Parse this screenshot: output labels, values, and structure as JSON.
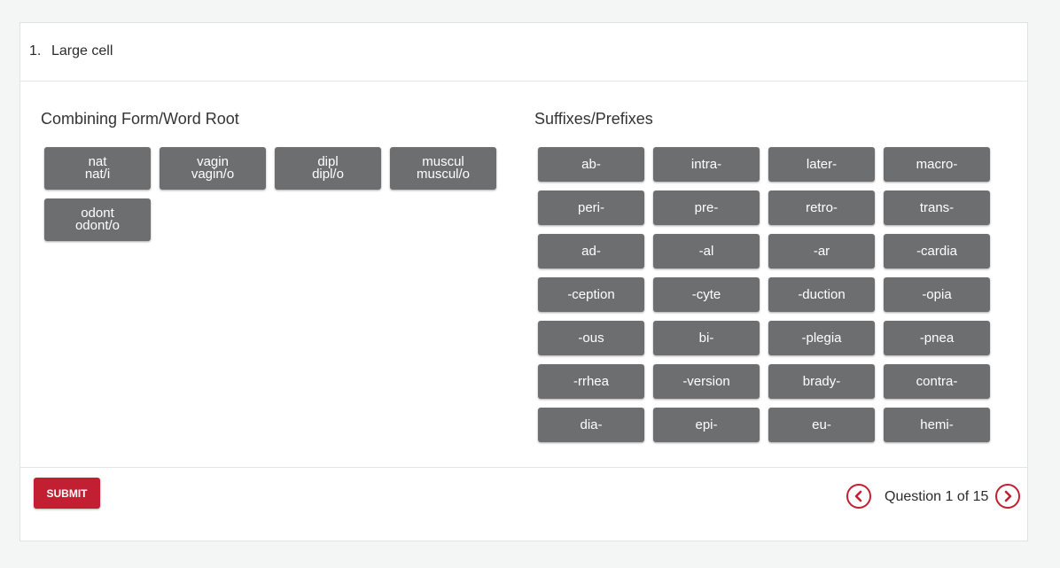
{
  "question": {
    "number": "1.",
    "text": "Large cell"
  },
  "left_section": {
    "title": "Combining Form/Word Root",
    "items": [
      {
        "line1": "nat",
        "line2": "nat/i"
      },
      {
        "line1": "vagin",
        "line2": "vagin/o"
      },
      {
        "line1": "dipl",
        "line2": "dipl/o"
      },
      {
        "line1": "muscul",
        "line2": "muscul/o"
      },
      {
        "line1": "odont",
        "line2": "odont/o"
      }
    ]
  },
  "right_section": {
    "title": "Suffixes/Prefixes",
    "items": [
      "ab-",
      "intra-",
      "later-",
      "macro-",
      "peri-",
      "pre-",
      "retro-",
      "trans-",
      "ad-",
      "-al",
      "-ar",
      "-cardia",
      "-ception",
      "-cyte",
      "-duction",
      "-opia",
      "-ous",
      "bi-",
      "-plegia",
      "-pnea",
      "-rrhea",
      "-version",
      "brady-",
      "contra-",
      "dia-",
      "epi-",
      "eu-",
      "hemi-"
    ]
  },
  "footer": {
    "submit_label": "SUBMIT",
    "counter": "Question 1 of 15",
    "prev_icon": "chevron-left-icon",
    "next_icon": "chevron-right-icon"
  },
  "colors": {
    "chip_bg": "#6d6e70",
    "accent": "#c21f32"
  }
}
